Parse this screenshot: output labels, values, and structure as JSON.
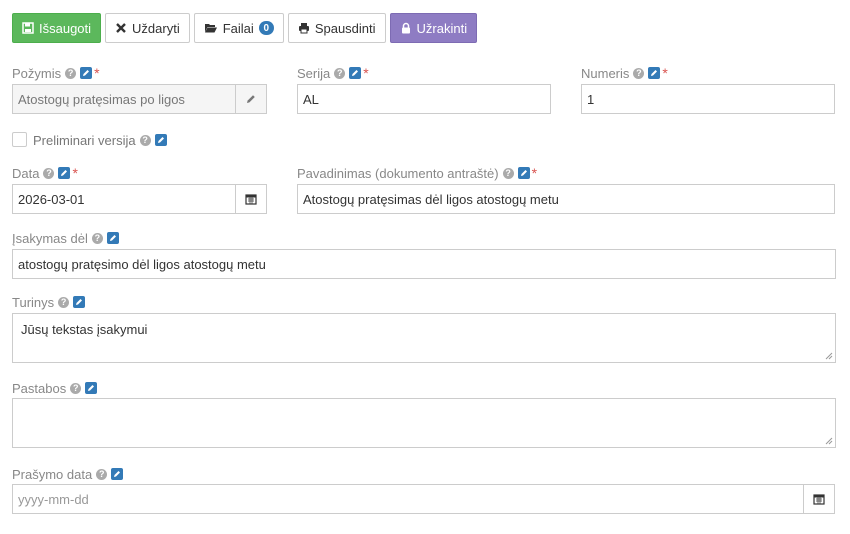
{
  "toolbar": {
    "save_label": "Išsaugoti",
    "close_label": "Uždaryti",
    "files_label": "Failai",
    "files_count": "0",
    "print_label": "Spausdinti",
    "lock_label": "Užrakinti"
  },
  "form": {
    "pozymis": {
      "label": "Požymis",
      "value": "Atostogų pratęsimas po ligos"
    },
    "serija": {
      "label": "Serija",
      "value": "AL"
    },
    "numeris": {
      "label": "Numeris",
      "value": "1"
    },
    "preliminari": {
      "label": "Preliminari versija",
      "checked": false
    },
    "data": {
      "label": "Data",
      "value": "2026-03-01"
    },
    "pavadinimas": {
      "label": "Pavadinimas (dokumento antraštė)",
      "value": "Atostogų pratęsimas dėl ligos atostogų metu"
    },
    "isakymas_del": {
      "label": "Įsakymas dėl",
      "value": "atostogų pratęsimo dėl ligos atostogų metu"
    },
    "turinys": {
      "label": "Turinys",
      "value": "Jūsų tekstas įsakymui"
    },
    "pastabos": {
      "label": "Pastabos",
      "value": ""
    },
    "prasymo_data": {
      "label": "Prašymo data",
      "placeholder": "yyyy-mm-dd"
    }
  },
  "colors": {
    "save": "#5cb85c",
    "lock": "#8e7cc3",
    "badge": "#337ab7",
    "required": "#d9534f",
    "edit_icon": "#337ab7"
  }
}
